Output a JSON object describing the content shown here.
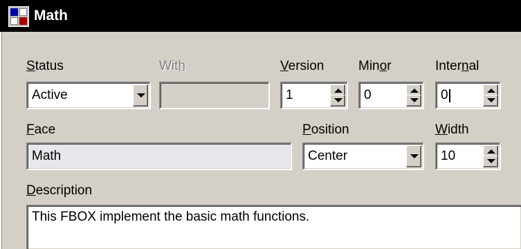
{
  "window": {
    "title": "Math"
  },
  "status": {
    "label_pre": "",
    "label_accel": "S",
    "label_post": "tatus",
    "value": "Active"
  },
  "with": {
    "label_pre": "Wit",
    "label_accel": "h",
    "label_post": "",
    "value": ""
  },
  "version": {
    "label_pre": "",
    "label_accel": "V",
    "label_post": "ersion",
    "value": "1"
  },
  "minor": {
    "label_pre": "Min",
    "label_accel": "o",
    "label_post": "r",
    "value": "0"
  },
  "internal": {
    "label_pre": "Inter",
    "label_accel": "n",
    "label_post": "al",
    "value": "0"
  },
  "face": {
    "label_pre": "",
    "label_accel": "F",
    "label_post": "ace",
    "value": "Math"
  },
  "position": {
    "label_pre": "",
    "label_accel": "P",
    "label_post": "osition",
    "value": "Center"
  },
  "width": {
    "label_pre": "",
    "label_accel": "W",
    "label_post": "idth",
    "value": "10"
  },
  "description": {
    "label_pre": "",
    "label_accel": "D",
    "label_post": "escription",
    "value": "This FBOX implement the basic math functions."
  }
}
